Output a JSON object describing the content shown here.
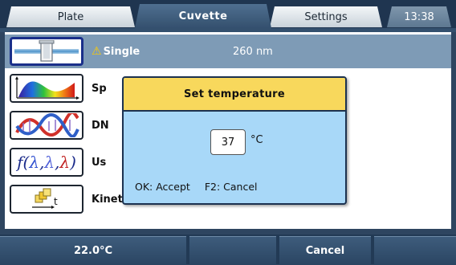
{
  "tabs": [
    {
      "label": "Plate",
      "active": false
    },
    {
      "label": "Cuvette",
      "active": true
    },
    {
      "label": "Settings",
      "active": false
    }
  ],
  "clock": "13:38",
  "apps": [
    {
      "label": "Single",
      "value": "260 nm",
      "warning": true,
      "icon": "cuvette-icon"
    },
    {
      "label": "Sp",
      "icon": "spectrum-icon"
    },
    {
      "label": "DN",
      "icon": "dna-helix-icon"
    },
    {
      "label": "Us",
      "icon": "user-function-icon"
    },
    {
      "label": "Kinetic",
      "icon": "kinetic-icon"
    }
  ],
  "dialog": {
    "title": "Set temperature",
    "value": "37",
    "unit": "°C",
    "ok_hint": "OK: Accept",
    "cancel_hint": "F2: Cancel"
  },
  "fkeys": [
    "22.0°C",
    "",
    "Cancel",
    ""
  ],
  "colors": {
    "dialog_bg": "#a8d8f8",
    "dialog_title_bg": "#f8d85c",
    "selected_row": "#7e9bb6",
    "warning": "#ffcc00"
  }
}
